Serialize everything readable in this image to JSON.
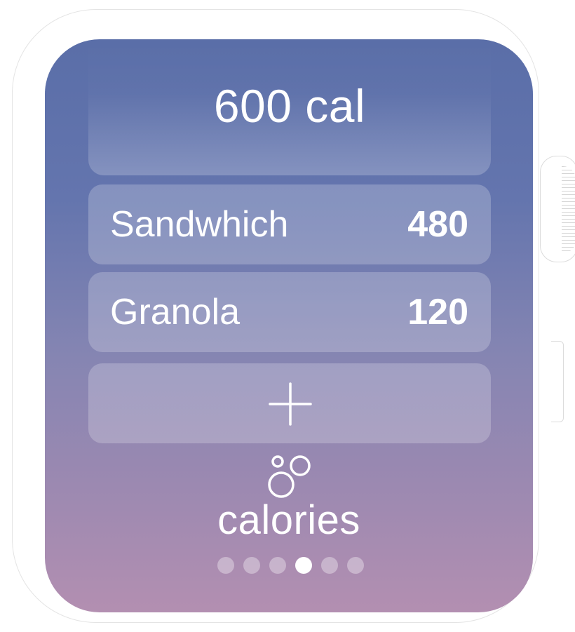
{
  "summary": {
    "total": "600 cal"
  },
  "entries": [
    {
      "label": "Sandwhich",
      "value": "480"
    },
    {
      "label": "Granola",
      "value": "120"
    }
  ],
  "add_button": {
    "icon": "plus-icon"
  },
  "app": {
    "name": "calories",
    "icon": "bubbles-icon"
  },
  "pagination": {
    "total_pages": 6,
    "current_page": 4
  },
  "colors": {
    "screen_top": "#5a6ea8",
    "screen_bottom": "#b38fb1",
    "text": "#ffffff"
  }
}
